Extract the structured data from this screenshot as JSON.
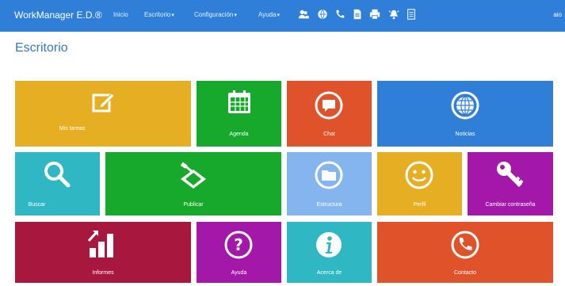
{
  "navbar": {
    "brand": "WorkManager E.D.®",
    "links": [
      "Inicio",
      "Escritorio",
      "Configuración",
      "Ayuda"
    ],
    "icons": [
      "users-icon",
      "globe-icon",
      "phone-icon",
      "document-icon",
      "printer-icon",
      "bell-icon",
      "list-icon"
    ],
    "user": "aio"
  },
  "page_title": "Escritorio",
  "tiles": [
    {
      "label": "Mis tareas",
      "icon": "edit-icon",
      "color": "#e6ae22"
    },
    {
      "label": "Agenda",
      "icon": "calendar-icon",
      "color": "#17a92b"
    },
    {
      "label": "Chat",
      "icon": "chat-icon",
      "color": "#e0522a"
    },
    {
      "label": "Noticias",
      "icon": "globe-icon",
      "color": "#2f7fd8"
    },
    {
      "label": "Buscar",
      "icon": "search-icon",
      "color": "#2fb7c4"
    },
    {
      "label": "Publicar",
      "icon": "scanner-icon",
      "color": "#17a92b"
    },
    {
      "label": "Estructura",
      "icon": "folder-icon",
      "color": "#85b5ee"
    },
    {
      "label": "Perfil",
      "icon": "smile-icon",
      "color": "#e6ae22"
    },
    {
      "label": "Cambiar contraseña",
      "icon": "key-icon",
      "color": "#a317a9"
    },
    {
      "label": "Informes",
      "icon": "chart-icon",
      "color": "#a8173e"
    },
    {
      "label": "Ayuda",
      "icon": "help-icon",
      "color": "#a317a9"
    },
    {
      "label": "Acerca de",
      "icon": "info-icon",
      "color": "#2fb7c4"
    },
    {
      "label": "Contacto",
      "icon": "phone-icon",
      "color": "#e0522a"
    }
  ]
}
